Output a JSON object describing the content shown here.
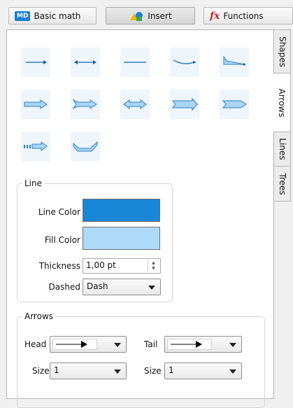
{
  "toolbar": {
    "buttons": [
      {
        "label": "Basic math",
        "badge": "MD",
        "icon": "md-badge-icon"
      },
      {
        "label": "Insert",
        "icon": "shapes-icon",
        "active": true
      },
      {
        "label": "Functions",
        "glyph": "fx",
        "icon": "fx-icon"
      }
    ]
  },
  "side_tabs": [
    {
      "label": "Shapes",
      "active": false
    },
    {
      "label": "Arrows",
      "active": true
    },
    {
      "label": "Lines",
      "active": false
    },
    {
      "label": "Trees",
      "active": false
    }
  ],
  "arrow_styles": [
    "arrow-right-thin",
    "arrow-double-thin",
    "line-plain",
    "arrow-curved",
    "arrow-wedge",
    "arrow-block-right",
    "arrow-block-notched",
    "arrow-block-double",
    "arrow-chevron-right",
    "arrow-pentagon",
    "arrow-dashed-block",
    "arrow-curved-band"
  ],
  "line_group": {
    "title": "Line",
    "line_color_label": "Line Color",
    "line_color": "#1a86d6",
    "fill_color_label": "Fill Color",
    "fill_color": "#addbf7",
    "thickness_label": "Thickness",
    "thickness_value": "1,00 pt",
    "dashed_label": "Dashed",
    "dashed_value": "Dash"
  },
  "arrows_group": {
    "title": "Arrows",
    "head_label": "Head",
    "tail_label": "Tail",
    "head_size_label": "Size",
    "head_size_value": "1",
    "tail_size_label": "Size",
    "tail_size_value": "1"
  },
  "colors": {
    "accent": "#1a7fd8",
    "tile_bg": "#eef5fb",
    "arrow_stroke": "#2f7fc4",
    "arrow_fill": "#a9d6f5"
  }
}
